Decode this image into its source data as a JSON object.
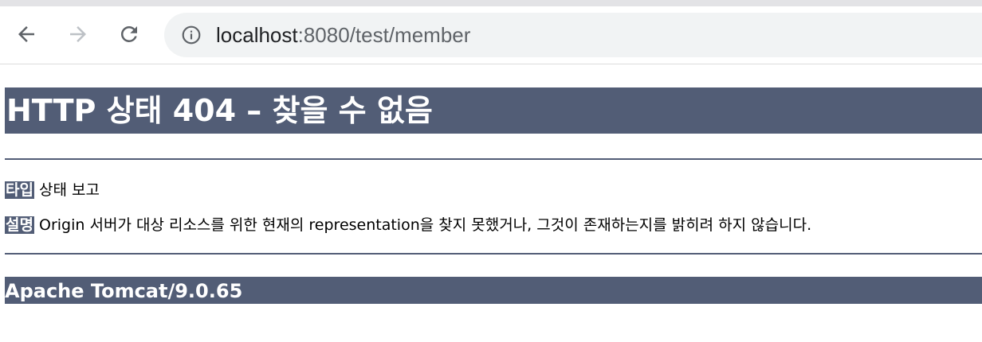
{
  "browser": {
    "url_host": "localhost",
    "url_path": ":8080/test/member"
  },
  "page": {
    "heading": "HTTP 상태 404 – 찾을 수 없음",
    "type_label": "타입",
    "type_value": "상태 보고",
    "desc_label": "설명",
    "desc_value": "Origin 서버가 대상 리소스를 위한 현재의 representation을 찾지 못했거나, 그것이 존재하는지를 밝히려 하지 않습니다.",
    "footer": "Apache Tomcat/9.0.65"
  },
  "colors": {
    "bar": "#525d76",
    "omnibox": "#f1f3f4"
  }
}
